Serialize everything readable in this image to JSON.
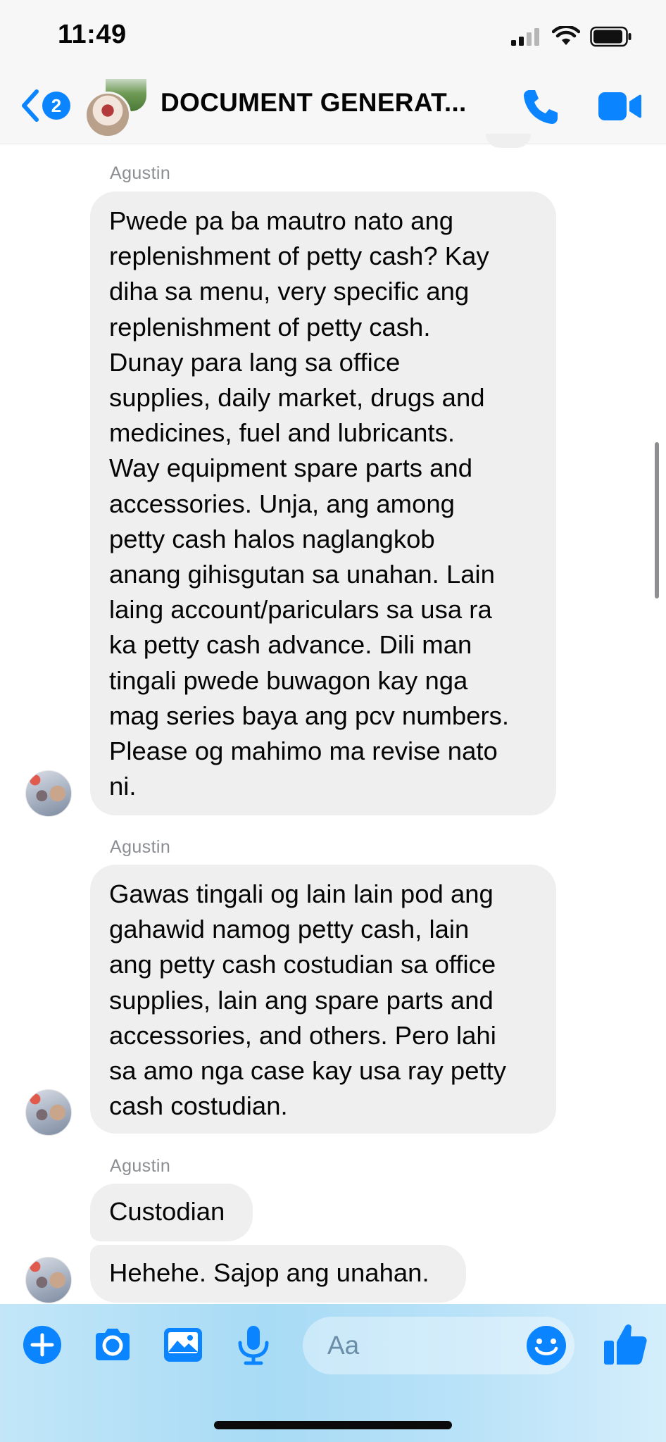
{
  "status_bar": {
    "time": "11:49"
  },
  "nav": {
    "unread_count": "2",
    "title": "DOCUMENT GENERAT..."
  },
  "messages": [
    {
      "sender": "Agustin",
      "text": "Pwede pa ba mautro nato ang\nreplenishment of petty cash? Kay\ndiha sa menu, very specific ang\nreplenishment of petty cash.\nDunay para lang sa office\nsupplies, daily market, drugs and\nmedicines, fuel and lubricants.\nWay equipment spare parts and\naccessories. Unja, ang among\npetty cash halos naglangkob\nanang gihisgutan sa unahan. Lain\nlaing account/pariculars sa usa ra\nka petty cash advance. Dili man\ntingali pwede buwagon kay nga\nmag series baya ang pcv numbers.\nPlease og mahimo ma revise nato\nni."
    },
    {
      "sender": "Agustin",
      "text": "Gawas tingali og lain lain pod ang\ngahawid namog petty cash, lain\nang petty cash costudian sa office\nsupplies, lain ang spare parts and\naccessories, and others. Pero lahi\nsa amo nga case kay usa ray petty\ncash costudian."
    },
    {
      "sender": "Agustin",
      "text": "Custodian"
    },
    {
      "text": "Hehehe. Sajop ang unahan."
    }
  ],
  "composer": {
    "placeholder": "Aa"
  },
  "colors": {
    "accent": "#0a84ff",
    "bubble": "#efefef",
    "composer_bg": "#b3e0f6"
  },
  "icons": [
    "back-chevron-icon",
    "phone-icon",
    "video-camera-icon",
    "plus-icon",
    "camera-icon",
    "gallery-icon",
    "microphone-icon",
    "emoji-icon",
    "thumbs-up-icon",
    "signal-icon",
    "wifi-icon",
    "battery-icon"
  ]
}
